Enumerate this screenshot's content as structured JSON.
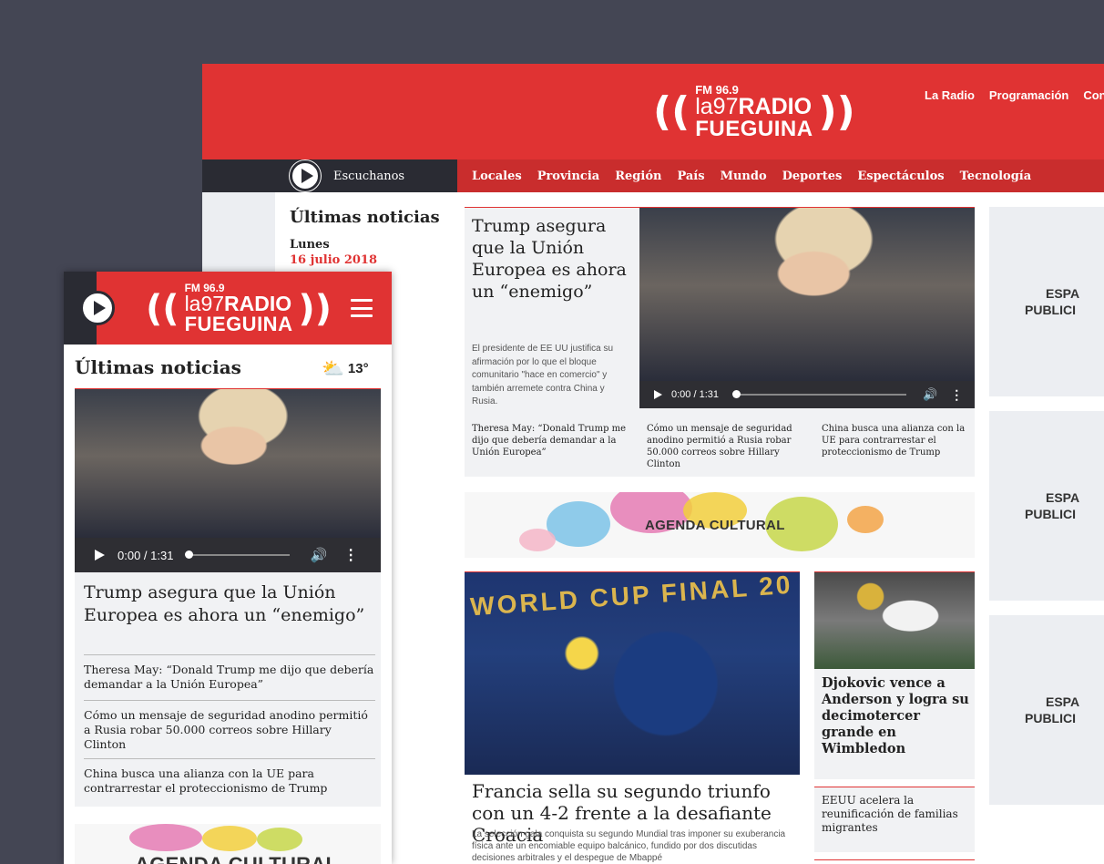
{
  "logo": {
    "fm": "FM 96.9",
    "la97": "la97",
    "radio": "RADIO",
    "fueguina": "FUEGUINA"
  },
  "desktop": {
    "topnav": [
      "La Radio",
      "Programación",
      "Contac"
    ],
    "listen_label": "Escuchanos",
    "sections": [
      "Locales",
      "Provincia",
      "Región",
      "País",
      "Mundo",
      "Deportes",
      "Espectáculos",
      "Tecnología"
    ],
    "latest_title": "Últimas noticias",
    "day": "Lunes",
    "date": "16 julio 2018",
    "main": {
      "title": "Trump asegura que la Unión Europea es ahora un “enemigo”",
      "description": "El presidente de EE UU justifica su afirmación por lo que el bloque comunitario \"hace en comercio\" y también arremete contra China y Rusia.",
      "player_time": "0:00 / 1:31",
      "related": [
        "Theresa May: “Donald Trump me dijo que debería demandar a la Unión Europea”",
        "Cómo un mensaje de seguridad anodino permitió a Rusia robar 50.000 correos sobre Hillary Clinton",
        "China busca una alianza con la UE para contrarrestar el proteccionismo de Trump"
      ]
    },
    "agenda_label": "AGENDA CULTURAL",
    "worldcup": {
      "banner": "WORLD CUP FINAL 20",
      "title": "Francia sella su segundo triunfo con un 4-2 frente a la desafiante Croacia",
      "description": "La selección gala conquista su segundo Mundial tras imponer su exuberancia física ante un encomiable equipo balcánico, fundido por dos discutidas decisiones arbitrales y el despegue de Mbappé"
    },
    "djokovic_title": "Djokovic vence a Anderson y logra su decimotercer grande en Wimbledon",
    "eeuu_title": "EEUU acelera la reunificación de familias migrantes",
    "ads": [
      {
        "line1": "ESPA",
        "line2": "PUBLICI"
      },
      {
        "line1": "ESPA",
        "line2": "PUBLICI"
      },
      {
        "line1": "ESPA",
        "line2": "PUBLICI"
      }
    ]
  },
  "mobile": {
    "latest_title": "Últimas noticias",
    "weather_icon": "partly-cloudy-icon",
    "temperature": "13°",
    "player_time": "0:00 / 1:31",
    "title": "Trump asegura que la Unión Europea es ahora un “enemigo”",
    "related": [
      "Theresa May: “Donald Trump me dijo que debería demandar a la Unión Europea”",
      "Cómo un mensaje de seguridad anodino permitió a Rusia robar 50.000 correos sobre Hillary Clinton",
      "China busca una alianza con la UE para contrarrestar el proteccionismo de Trump"
    ],
    "agenda_label": "AGENDA CULTURAL"
  },
  "colors": {
    "brand_red": "#e03333",
    "dark": "#2a2b33",
    "background": "#444654"
  }
}
